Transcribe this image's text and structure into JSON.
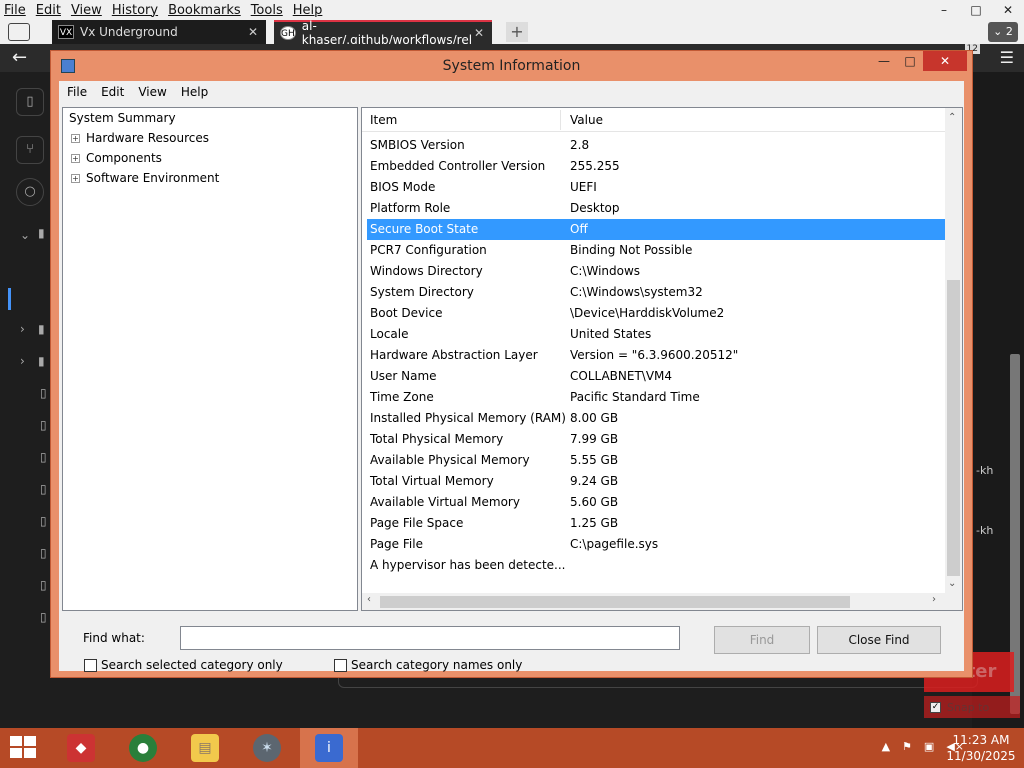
{
  "browser": {
    "menu": [
      "File",
      "Edit",
      "View",
      "History",
      "Bookmarks",
      "Tools",
      "Help"
    ],
    "window_controls": [
      "–",
      "□",
      "✕"
    ],
    "tabs": [
      {
        "favicon": "VX",
        "title": "Vx Underground",
        "close": "✕"
      },
      {
        "favicon": "GH",
        "title": "al-khaser/.github/workflows/rel",
        "close": "✕"
      }
    ],
    "new_tab": "+",
    "tab_count": "2",
    "notif_count": "12"
  },
  "page_bg": {
    "right_fragments": [
      "-kh",
      "-kh"
    ],
    "enter_label": "Enter",
    "snap_label": "Snap to"
  },
  "sysinfo": {
    "title": "System Information",
    "menu": [
      "File",
      "Edit",
      "View",
      "Help"
    ],
    "tree": {
      "root": "System Summary",
      "children": [
        "Hardware Resources",
        "Components",
        "Software Environment"
      ]
    },
    "columns": {
      "item": "Item",
      "value": "Value"
    },
    "rows": [
      {
        "item": "SMBIOS Version",
        "value": "2.8"
      },
      {
        "item": "Embedded Controller Version",
        "value": "255.255"
      },
      {
        "item": "BIOS Mode",
        "value": "UEFI"
      },
      {
        "item": "Platform Role",
        "value": "Desktop"
      },
      {
        "item": "Secure Boot State",
        "value": "Off"
      },
      {
        "item": "PCR7 Configuration",
        "value": "Binding Not Possible"
      },
      {
        "item": "Windows Directory",
        "value": "C:\\Windows"
      },
      {
        "item": "System Directory",
        "value": "C:\\Windows\\system32"
      },
      {
        "item": "Boot Device",
        "value": "\\Device\\HarddiskVolume2"
      },
      {
        "item": "Locale",
        "value": "United States"
      },
      {
        "item": "Hardware Abstraction Layer",
        "value": "Version = \"6.3.9600.20512\""
      },
      {
        "item": "User Name",
        "value": "COLLABNET\\VM4"
      },
      {
        "item": "Time Zone",
        "value": "Pacific Standard Time"
      },
      {
        "item": "Installed Physical Memory (RAM)",
        "value": "8.00 GB"
      },
      {
        "item": "Total Physical Memory",
        "value": "7.99 GB"
      },
      {
        "item": "Available Physical Memory",
        "value": "5.55 GB"
      },
      {
        "item": "Total Virtual Memory",
        "value": "9.24 GB"
      },
      {
        "item": "Available Virtual Memory",
        "value": "5.60 GB"
      },
      {
        "item": "Page File Space",
        "value": "1.25 GB"
      },
      {
        "item": "Page File",
        "value": "C:\\pagefile.sys"
      },
      {
        "item": "A hypervisor has been detecte...",
        "value": ""
      }
    ],
    "selected_row": "Secure Boot State",
    "find": {
      "label": "Find what:",
      "value": "",
      "find_button": "Find",
      "close_find_button": "Close Find",
      "chk_selected_category": "Search selected category only",
      "chk_category_names": "Search category names only"
    }
  },
  "taskbar": {
    "clock_time": "11:23 AM",
    "clock_date": "11/30/2025",
    "tray_icons": [
      "up-arrow-icon",
      "flag-icon",
      "network-icon",
      "volume-muted-icon"
    ],
    "colors": {
      "taskbar": "#b64a26",
      "selection": "#3399ff",
      "window_frame": "#e9906a"
    }
  }
}
